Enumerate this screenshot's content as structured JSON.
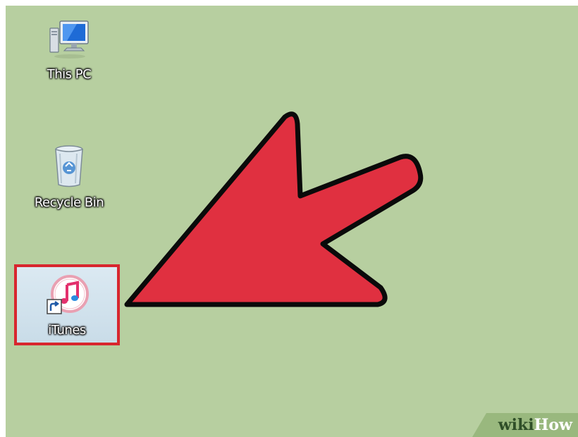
{
  "desktop": {
    "background_color": "#b7cfa0",
    "icons": [
      {
        "label": "This PC",
        "icon": "computer-icon"
      },
      {
        "label": "Recycle Bin",
        "icon": "recycle-bin-icon"
      },
      {
        "label": "iTunes",
        "icon": "itunes-shortcut-icon",
        "selected": true
      }
    ]
  },
  "annotation": {
    "arrow_color": "#e03040",
    "highlight_color": "#d8262e"
  },
  "watermark": {
    "wiki": "wiki",
    "how": "How"
  }
}
